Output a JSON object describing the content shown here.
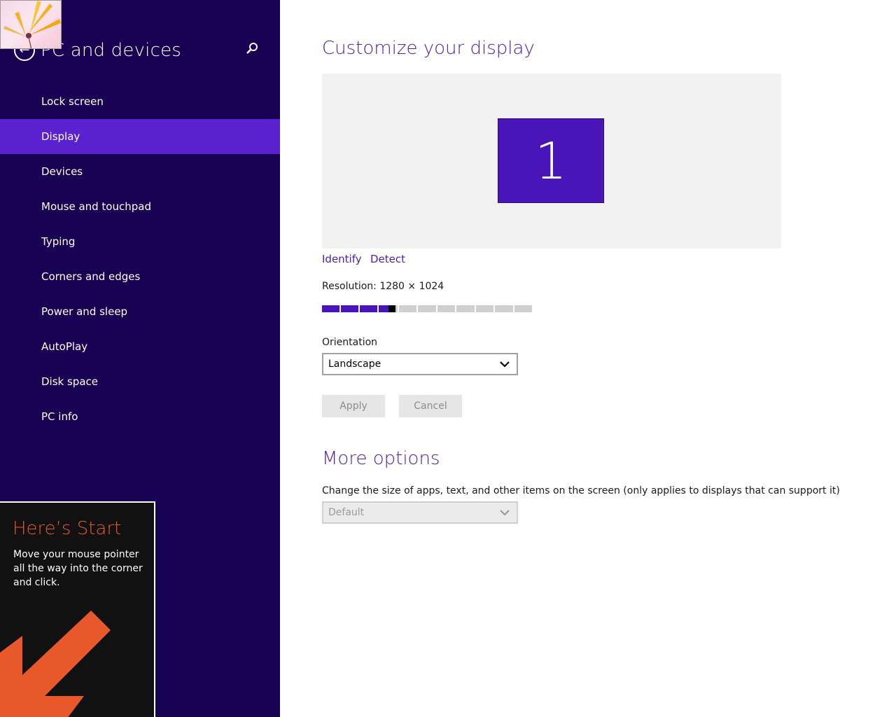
{
  "sidebar": {
    "title": "PC and devices",
    "back_icon": "back-arrow-icon",
    "search_icon": "search-icon",
    "items": [
      {
        "label": "Lock screen",
        "selected": false
      },
      {
        "label": "Display",
        "selected": true
      },
      {
        "label": "Devices",
        "selected": false
      },
      {
        "label": "Mouse and touchpad",
        "selected": false
      },
      {
        "label": "Typing",
        "selected": false
      },
      {
        "label": "Corners and edges",
        "selected": false
      },
      {
        "label": "Power and sleep",
        "selected": false
      },
      {
        "label": "AutoPlay",
        "selected": false
      },
      {
        "label": "Disk space",
        "selected": false
      },
      {
        "label": "PC info",
        "selected": false
      }
    ]
  },
  "start_tip": {
    "title": "Here’s Start",
    "body": "Move your mouse pointer all the way into the corner and click.",
    "arrow_icon": "arrow-down-left-icon"
  },
  "display": {
    "title": "Customize your display",
    "monitor_number": "1",
    "identify_label": "Identify",
    "detect_label": "Detect",
    "resolution_label": "Resolution: 1280 × 1024",
    "resolution_level": 0.35,
    "orientation_label": "Orientation",
    "orientation_value": "Landscape",
    "apply_label": "Apply",
    "cancel_label": "Cancel"
  },
  "more_options": {
    "title": "More options",
    "size_label": "Change the size of apps, text, and other items on the screen (only applies to displays that can support it)",
    "size_value": "Default"
  },
  "colors": {
    "sidebar_bg": "#180052",
    "selected_bg": "#5a21cf",
    "accent": "#4a15b8",
    "start_title": "#e8582a"
  }
}
